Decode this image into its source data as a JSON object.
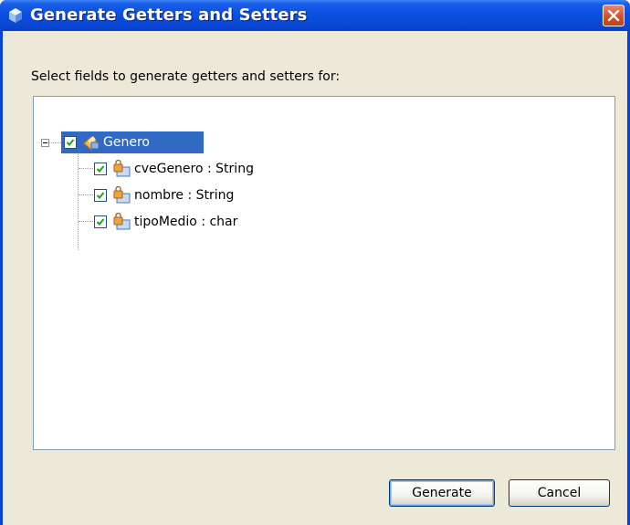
{
  "window": {
    "title": "Generate Getters and Setters",
    "close_icon": "close-icon"
  },
  "instruction": "Select fields to generate getters and setters for:",
  "tree": {
    "root": {
      "label": "Genero",
      "checked": true,
      "expanded": true,
      "selected": true,
      "icon": "class-icon"
    },
    "fields": [
      {
        "label": "cveGenero : String",
        "checked": true,
        "icon": "private-field-icon"
      },
      {
        "label": "nombre : String",
        "checked": true,
        "icon": "private-field-icon"
      },
      {
        "label": "tipoMedio : char",
        "checked": true,
        "icon": "private-field-icon"
      }
    ]
  },
  "buttons": {
    "generate": "Generate",
    "cancel": "Cancel"
  },
  "colors": {
    "titlebar": "#0a4fdf",
    "selection": "#316ac5",
    "dialog_bg": "#ece9d8",
    "close_button": "#d5502b"
  }
}
